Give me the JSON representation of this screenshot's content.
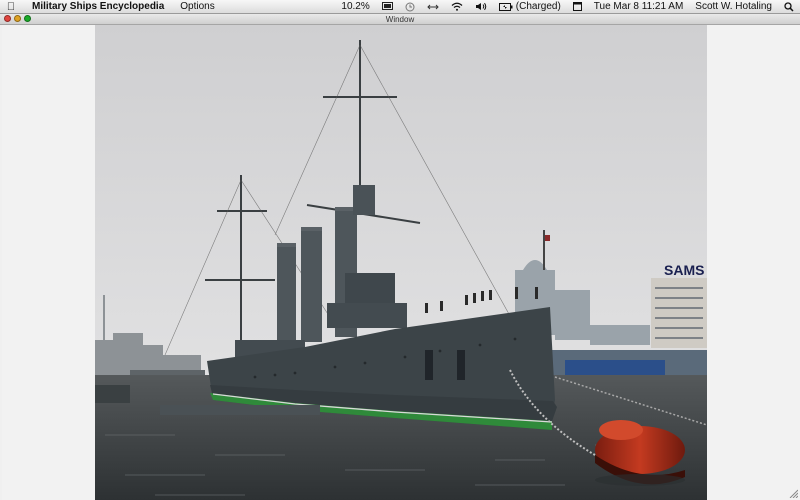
{
  "menubar": {
    "app_name": "Military Ships Encyclopedia",
    "menus": [
      "Options"
    ],
    "status": {
      "cpu": "10.2%",
      "battery": "(Charged)",
      "date_time": "Tue Mar 8  11:21 AM",
      "user": "Scott W. Hotaling"
    },
    "icons": [
      "apple-icon",
      "display-icon",
      "time-machine-icon",
      "sync-icon",
      "wifi-icon",
      "volume-icon",
      "battery-icon",
      "calendar-icon",
      "spotlight-icon"
    ]
  },
  "window": {
    "title": "Window",
    "traffic_lights": {
      "close": "#e0443e",
      "minimize": "#dea123",
      "zoom": "#1aab29"
    }
  },
  "photo": {
    "subject": "cruiser-warship",
    "sign_text": "SAMS",
    "colors": {
      "sky": "#d8d8d8",
      "water": "#3e4346",
      "hull": "#3c4448",
      "waterline": "#2f8a3a",
      "buoy": "#b3321c"
    }
  }
}
